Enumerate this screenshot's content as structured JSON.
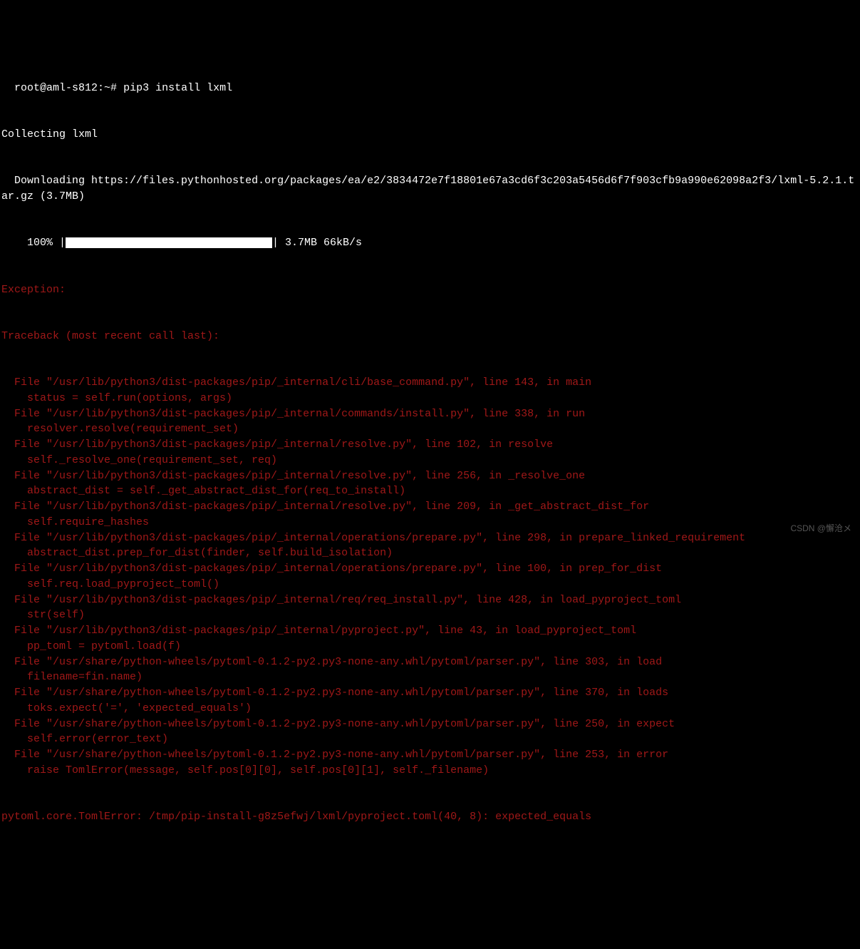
{
  "prompt": "root@aml-s812:~#",
  "command": "pip3 install lxml",
  "collecting": "Collecting lxml",
  "downloading": "  Downloading https://files.pythonhosted.org/packages/ea/e2/3834472e7f18801e67a3cd6f3c203a5456d6f7f903cfb9a990e62098a2f3/lxml-5.2.1.tar.gz (3.7MB)",
  "progress_indent": "    100% |",
  "progress_tail": "| 3.7MB 66kB/s",
  "exception_label": "Exception:",
  "traceback_label": "Traceback (most recent call last):",
  "frames": [
    {
      "file": "  File \"/usr/lib/python3/dist-packages/pip/_internal/cli/base_command.py\", line 143, in main",
      "code": "    status = self.run(options, args)"
    },
    {
      "file": "  File \"/usr/lib/python3/dist-packages/pip/_internal/commands/install.py\", line 338, in run",
      "code": "    resolver.resolve(requirement_set)"
    },
    {
      "file": "  File \"/usr/lib/python3/dist-packages/pip/_internal/resolve.py\", line 102, in resolve",
      "code": "    self._resolve_one(requirement_set, req)"
    },
    {
      "file": "  File \"/usr/lib/python3/dist-packages/pip/_internal/resolve.py\", line 256, in _resolve_one",
      "code": "    abstract_dist = self._get_abstract_dist_for(req_to_install)"
    },
    {
      "file": "  File \"/usr/lib/python3/dist-packages/pip/_internal/resolve.py\", line 209, in _get_abstract_dist_for",
      "code": "    self.require_hashes"
    },
    {
      "file": "  File \"/usr/lib/python3/dist-packages/pip/_internal/operations/prepare.py\", line 298, in prepare_linked_requirement",
      "code": "    abstract_dist.prep_for_dist(finder, self.build_isolation)"
    },
    {
      "file": "  File \"/usr/lib/python3/dist-packages/pip/_internal/operations/prepare.py\", line 100, in prep_for_dist",
      "code": "    self.req.load_pyproject_toml()"
    },
    {
      "file": "  File \"/usr/lib/python3/dist-packages/pip/_internal/req/req_install.py\", line 428, in load_pyproject_toml",
      "code": "    str(self)"
    },
    {
      "file": "  File \"/usr/lib/python3/dist-packages/pip/_internal/pyproject.py\", line 43, in load_pyproject_toml",
      "code": "    pp_toml = pytoml.load(f)"
    },
    {
      "file": "  File \"/usr/share/python-wheels/pytoml-0.1.2-py2.py3-none-any.whl/pytoml/parser.py\", line 303, in load",
      "code": "    filename=fin.name)"
    },
    {
      "file": "  File \"/usr/share/python-wheels/pytoml-0.1.2-py2.py3-none-any.whl/pytoml/parser.py\", line 370, in loads",
      "code": "    toks.expect('=', 'expected_equals')"
    },
    {
      "file": "  File \"/usr/share/python-wheels/pytoml-0.1.2-py2.py3-none-any.whl/pytoml/parser.py\", line 250, in expect",
      "code": "    self.error(error_text)"
    },
    {
      "file": "  File \"/usr/share/python-wheels/pytoml-0.1.2-py2.py3-none-any.whl/pytoml/parser.py\", line 253, in error",
      "code": "    raise TomlError(message, self.pos[0][0], self.pos[0][1], self._filename)"
    }
  ],
  "final_error": "pytoml.core.TomlError: /tmp/pip-install-g8z5efwj/lxml/pyproject.toml(40, 8): expected_equals",
  "watermark": "CSDN @懈沧メ"
}
